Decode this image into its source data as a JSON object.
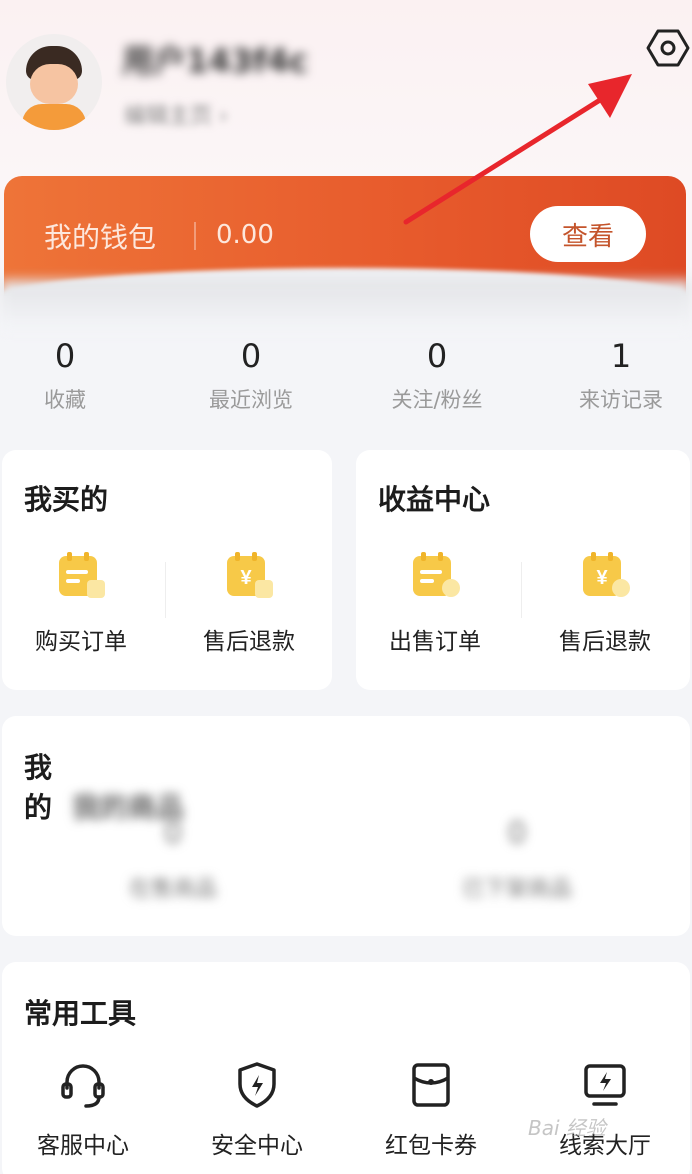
{
  "header": {
    "username": "用户143f4c",
    "subline": "编辑主页 ›",
    "settings_icon": "gear-icon"
  },
  "wallet": {
    "title": "我的钱包",
    "amount": "0.00",
    "view_button": "查看"
  },
  "stats": [
    {
      "value": "0",
      "label": "收藏"
    },
    {
      "value": "0",
      "label": "最近浏览"
    },
    {
      "value": "0",
      "label": "关注/粉丝"
    },
    {
      "value": "1",
      "label": "来访记录"
    }
  ],
  "bought": {
    "title": "我买的",
    "items": [
      {
        "label": "购买订单",
        "icon": "order-icon"
      },
      {
        "label": "售后退款",
        "icon": "refund-icon"
      }
    ]
  },
  "income": {
    "title": "收益中心",
    "items": [
      {
        "label": "出售订单",
        "icon": "sale-order-icon"
      },
      {
        "label": "售后退款",
        "icon": "refund-icon"
      }
    ]
  },
  "products": {
    "title": "我的商品",
    "items": [
      {
        "value": "0",
        "label": "在售商品"
      },
      {
        "value": "0",
        "label": "已下架商品"
      }
    ]
  },
  "tools": {
    "title": "常用工具",
    "items": [
      {
        "label": "客服中心",
        "icon": "headset-icon"
      },
      {
        "label": "安全中心",
        "icon": "shield-icon"
      },
      {
        "label": "红包卡券",
        "icon": "red-packet-icon"
      },
      {
        "label": "线索大厅",
        "icon": "monitor-icon"
      }
    ]
  },
  "watermark": "Bai 经验",
  "colors": {
    "wallet_start": "#ee7438",
    "wallet_end": "#de4a24",
    "accent_text": "#c4542b",
    "icon_yellow": "#f7c948",
    "arrow_red": "#e8262c"
  }
}
